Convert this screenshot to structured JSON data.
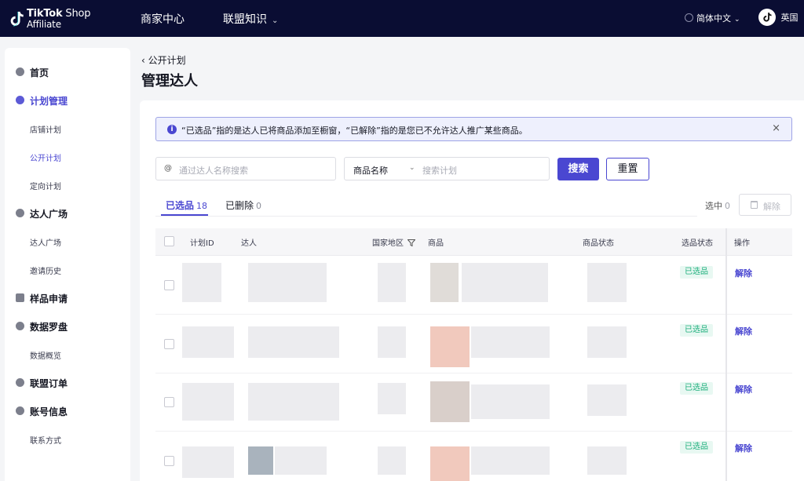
{
  "header": {
    "brand_line1": "TikTok",
    "brand_line1b": " Shop",
    "brand_line2": "Affiliate",
    "nav": [
      {
        "label": "商家中心"
      },
      {
        "label": "联盟知识"
      }
    ],
    "language": "简体中文",
    "region": "英国"
  },
  "sidebar": {
    "items": [
      {
        "label": "首页"
      },
      {
        "label": "计划管理"
      },
      {
        "label": "达人广场"
      },
      {
        "label": "样品申请"
      },
      {
        "label": "数据罗盘"
      },
      {
        "label": "联盟订单"
      },
      {
        "label": "账号信息"
      }
    ],
    "subitems": [
      {
        "label": "店铺计划"
      },
      {
        "label": "公开计划"
      },
      {
        "label": "定向计划"
      },
      {
        "label": "达人广场"
      },
      {
        "label": "邀请历史"
      },
      {
        "label": "数据概览"
      },
      {
        "label": "联系方式"
      }
    ]
  },
  "page": {
    "back_label": "公开计划",
    "title": "管理达人"
  },
  "notice": {
    "text": "“已选品”指的是达人已将商品添加至橱窗，“已解除”指的是您已不允许达人推广某些商品。",
    "close": "×"
  },
  "search": {
    "creator_prefix": "@",
    "creator_placeholder": "通过达人名称搜索",
    "field_select": "商品名称",
    "plan_placeholder": "搜索计划",
    "search_button": "搜索",
    "reset_button": "重置"
  },
  "tabs": [
    {
      "label": "已选品",
      "count": "18"
    },
    {
      "label": "已删除",
      "count": "0"
    }
  ],
  "selection": {
    "label": "选中",
    "count": "0",
    "remove_label": "解除"
  },
  "table": {
    "columns": [
      "计划ID",
      "达人",
      "国家地区",
      "商品",
      "商品状态",
      "选品状态",
      "操作"
    ],
    "rows": [
      {
        "status": "已选品",
        "action": "解除"
      },
      {
        "status": "已选品",
        "action": "解除"
      },
      {
        "status": "已选品",
        "action": "解除"
      },
      {
        "status": "已选品",
        "action": "解除"
      }
    ]
  },
  "colors": {
    "accent": "#4a47d1",
    "topbar": "#0a0d33",
    "status_green": "#1cae7b"
  }
}
